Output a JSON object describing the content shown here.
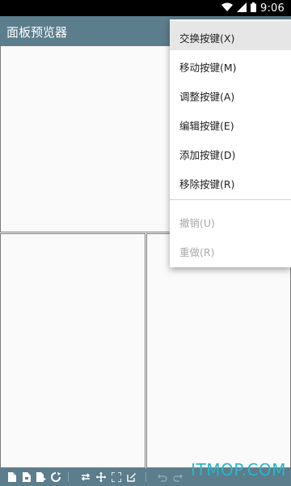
{
  "status_bar": {
    "time": "9:06",
    "icons": [
      "wifi-icon",
      "signal-icon",
      "battery-icon"
    ]
  },
  "app_bar": {
    "title": "面板预览器",
    "color": "#5c7d8c"
  },
  "menu": {
    "items": [
      {
        "label": "交换按键(X)",
        "state": "selected"
      },
      {
        "label": "移动按键(M)",
        "state": "enabled"
      },
      {
        "label": "调整按键(A)",
        "state": "enabled"
      },
      {
        "label": "编辑按键(E)",
        "state": "enabled"
      },
      {
        "label": "添加按键(D)",
        "state": "enabled"
      },
      {
        "label": "移除按键(R)",
        "state": "enabled"
      },
      {
        "label": "撤销(U)",
        "state": "disabled"
      },
      {
        "label": "重做(R)",
        "state": "disabled"
      }
    ]
  },
  "bottom_toolbar": {
    "icons": [
      "new-file-icon",
      "open-file-icon",
      "save-file-icon",
      "refresh-icon",
      "swap-icon",
      "move-icon",
      "resize-icon",
      "edit-icon",
      "undo-icon",
      "redo-icon"
    ]
  },
  "watermark": "ITMOP.COM"
}
